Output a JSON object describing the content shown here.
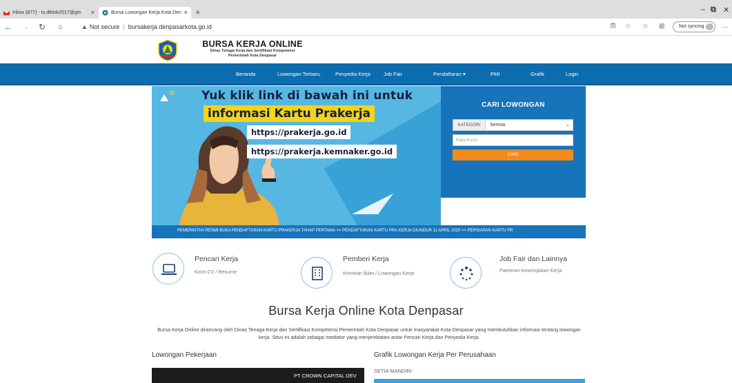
{
  "browser": {
    "tabs": [
      {
        "title": "Inbox (877) - tu.dtkisk2017@gm",
        "icon": "gmail-icon"
      },
      {
        "title": "Bursa Lowongan Kerja Kota Den",
        "icon": "site-favicon"
      }
    ],
    "security_label": "Not secure",
    "url": "bursakerja.denpasarkota.go.id",
    "sync_label": "Not syncing"
  },
  "site": {
    "title": "BURSA KERJA ONLINE",
    "subtitle_1": "Dinas Tenaga Kerja dan Sertifikasi Kompetensi",
    "subtitle_2": "Pemerintah Kota Denpasar"
  },
  "nav": {
    "items": [
      "Beranda",
      "Lowongan Terbaru",
      "Penyedia Kerja",
      "Job Fair",
      "Pendaftaran ▾",
      "PMI",
      "Grafik",
      "Login"
    ]
  },
  "banner": {
    "line1": "Yuk klik link di bawah ini untuk",
    "line2": "informasi Kartu Prakerja",
    "url1": "https://prakerja.go.id",
    "url2": "https://prakerja.kemnaker.go.id"
  },
  "search": {
    "title": "CARI LOWONGAN",
    "category_label": "KATEGORI",
    "category_value": "Semua",
    "keyword_placeholder": "Kata Kunci",
    "button": "CARI"
  },
  "ticker": {
    "text": "PEMERINTAH RESMI BUKA PENDAFTARAN KARTU PRAKERJA TAHAP PERTAMA >> PENDAFTARAN KARTU PRA KERJA DIUNDUR 11 APRIL 2020 >> PERSIAPAN KARTU PR"
  },
  "features": [
    {
      "title": "Pencari Kerja",
      "desc": "Kirim CV / Resume",
      "icon": "laptop-icon"
    },
    {
      "title": "Pemberi Kerja",
      "desc": "Kirimkan Iklan / Lowongan Kerja",
      "icon": "building-icon"
    },
    {
      "title": "Job Fair dan Lainnya",
      "desc": "Pameran Kesempatan Kerja",
      "icon": "spinner-icon"
    }
  ],
  "about": {
    "title": "Bursa Kerja Online Kota Denpasar",
    "text": "Bursa Kerja Online dirancang oleh Dinas Tenaga Kerja dan Sertifikasi Kompetensi Pemerintah Kota Denpasar untuk masyarakat Kota Denpasar yang membutuhkan informasi tentang lowongan kerja. Situs ini adalah sebagai mediator yang menjembatani antar Pencari Kerja dan Penyedia Kerja."
  },
  "sections": {
    "jobs_title": "Lowongan Pekerjaan",
    "job_card": "PT CROWN CAPITAL DEV",
    "chart_title": "Grafik Lowongan Kerja Per Perusahaan",
    "chart_first_label": "SETIA MANDIRI"
  },
  "colors": {
    "nav": "#0d6cae",
    "search_panel": "#1773ba",
    "search_button": "#f28a1c",
    "banner_bg": "#56b7e3",
    "banner_highlight": "#f6d319"
  }
}
